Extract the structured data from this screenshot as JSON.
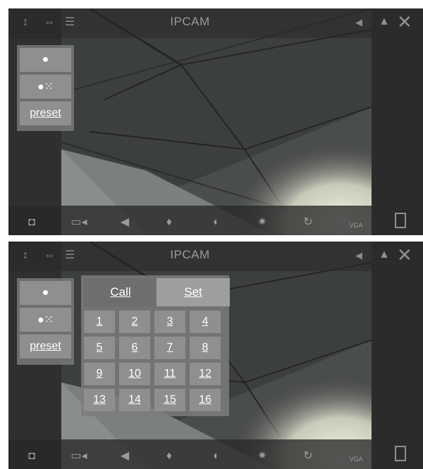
{
  "app_title": "IPCAM",
  "left_panel": {
    "light_off_icon": "light-icon",
    "light_on_icon": "light-rays-icon",
    "preset_label": "preset"
  },
  "preset_panel": {
    "call_label": "Call",
    "set_label": "Set",
    "numbers": [
      "1",
      "2",
      "3",
      "4",
      "5",
      "6",
      "7",
      "8",
      "9",
      "10",
      "11",
      "12",
      "13",
      "14",
      "15",
      "16"
    ]
  },
  "bottom_bar": {
    "resolution_label": "VGA"
  },
  "icons": {
    "top": [
      "flip-vertical-icon",
      "flip-horizontal-icon",
      "menu-icon",
      "speaker-icon",
      "triangle-icon",
      "close-icon"
    ],
    "bottom": [
      "camera-icon",
      "video-icon",
      "speaker-icon",
      "microphone-icon",
      "contrast-icon",
      "brightness-icon",
      "rotate-icon",
      "vga-label",
      "fullscreen-icon"
    ]
  }
}
